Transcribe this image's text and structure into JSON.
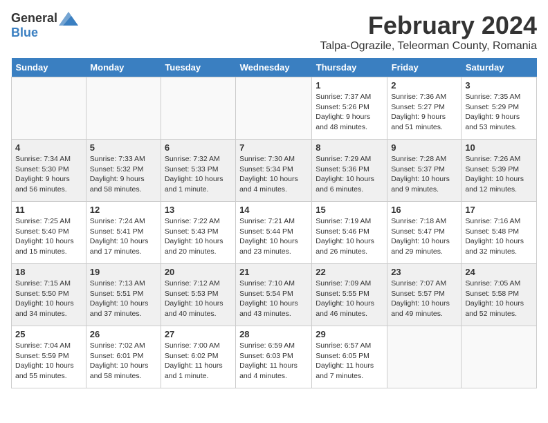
{
  "header": {
    "logo_general": "General",
    "logo_blue": "Blue",
    "month_title": "February 2024",
    "location": "Talpa-Ograzile, Teleorman County, Romania"
  },
  "days_of_week": [
    "Sunday",
    "Monday",
    "Tuesday",
    "Wednesday",
    "Thursday",
    "Friday",
    "Saturday"
  ],
  "weeks": [
    [
      {
        "day": "",
        "info": ""
      },
      {
        "day": "",
        "info": ""
      },
      {
        "day": "",
        "info": ""
      },
      {
        "day": "",
        "info": ""
      },
      {
        "day": "1",
        "info": "Sunrise: 7:37 AM\nSunset: 5:26 PM\nDaylight: 9 hours and 48 minutes."
      },
      {
        "day": "2",
        "info": "Sunrise: 7:36 AM\nSunset: 5:27 PM\nDaylight: 9 hours and 51 minutes."
      },
      {
        "day": "3",
        "info": "Sunrise: 7:35 AM\nSunset: 5:29 PM\nDaylight: 9 hours and 53 minutes."
      }
    ],
    [
      {
        "day": "4",
        "info": "Sunrise: 7:34 AM\nSunset: 5:30 PM\nDaylight: 9 hours and 56 minutes."
      },
      {
        "day": "5",
        "info": "Sunrise: 7:33 AM\nSunset: 5:32 PM\nDaylight: 9 hours and 58 minutes."
      },
      {
        "day": "6",
        "info": "Sunrise: 7:32 AM\nSunset: 5:33 PM\nDaylight: 10 hours and 1 minute."
      },
      {
        "day": "7",
        "info": "Sunrise: 7:30 AM\nSunset: 5:34 PM\nDaylight: 10 hours and 4 minutes."
      },
      {
        "day": "8",
        "info": "Sunrise: 7:29 AM\nSunset: 5:36 PM\nDaylight: 10 hours and 6 minutes."
      },
      {
        "day": "9",
        "info": "Sunrise: 7:28 AM\nSunset: 5:37 PM\nDaylight: 10 hours and 9 minutes."
      },
      {
        "day": "10",
        "info": "Sunrise: 7:26 AM\nSunset: 5:39 PM\nDaylight: 10 hours and 12 minutes."
      }
    ],
    [
      {
        "day": "11",
        "info": "Sunrise: 7:25 AM\nSunset: 5:40 PM\nDaylight: 10 hours and 15 minutes."
      },
      {
        "day": "12",
        "info": "Sunrise: 7:24 AM\nSunset: 5:41 PM\nDaylight: 10 hours and 17 minutes."
      },
      {
        "day": "13",
        "info": "Sunrise: 7:22 AM\nSunset: 5:43 PM\nDaylight: 10 hours and 20 minutes."
      },
      {
        "day": "14",
        "info": "Sunrise: 7:21 AM\nSunset: 5:44 PM\nDaylight: 10 hours and 23 minutes."
      },
      {
        "day": "15",
        "info": "Sunrise: 7:19 AM\nSunset: 5:46 PM\nDaylight: 10 hours and 26 minutes."
      },
      {
        "day": "16",
        "info": "Sunrise: 7:18 AM\nSunset: 5:47 PM\nDaylight: 10 hours and 29 minutes."
      },
      {
        "day": "17",
        "info": "Sunrise: 7:16 AM\nSunset: 5:48 PM\nDaylight: 10 hours and 32 minutes."
      }
    ],
    [
      {
        "day": "18",
        "info": "Sunrise: 7:15 AM\nSunset: 5:50 PM\nDaylight: 10 hours and 34 minutes."
      },
      {
        "day": "19",
        "info": "Sunrise: 7:13 AM\nSunset: 5:51 PM\nDaylight: 10 hours and 37 minutes."
      },
      {
        "day": "20",
        "info": "Sunrise: 7:12 AM\nSunset: 5:53 PM\nDaylight: 10 hours and 40 minutes."
      },
      {
        "day": "21",
        "info": "Sunrise: 7:10 AM\nSunset: 5:54 PM\nDaylight: 10 hours and 43 minutes."
      },
      {
        "day": "22",
        "info": "Sunrise: 7:09 AM\nSunset: 5:55 PM\nDaylight: 10 hours and 46 minutes."
      },
      {
        "day": "23",
        "info": "Sunrise: 7:07 AM\nSunset: 5:57 PM\nDaylight: 10 hours and 49 minutes."
      },
      {
        "day": "24",
        "info": "Sunrise: 7:05 AM\nSunset: 5:58 PM\nDaylight: 10 hours and 52 minutes."
      }
    ],
    [
      {
        "day": "25",
        "info": "Sunrise: 7:04 AM\nSunset: 5:59 PM\nDaylight: 10 hours and 55 minutes."
      },
      {
        "day": "26",
        "info": "Sunrise: 7:02 AM\nSunset: 6:01 PM\nDaylight: 10 hours and 58 minutes."
      },
      {
        "day": "27",
        "info": "Sunrise: 7:00 AM\nSunset: 6:02 PM\nDaylight: 11 hours and 1 minute."
      },
      {
        "day": "28",
        "info": "Sunrise: 6:59 AM\nSunset: 6:03 PM\nDaylight: 11 hours and 4 minutes."
      },
      {
        "day": "29",
        "info": "Sunrise: 6:57 AM\nSunset: 6:05 PM\nDaylight: 11 hours and 7 minutes."
      },
      {
        "day": "",
        "info": ""
      },
      {
        "day": "",
        "info": ""
      }
    ]
  ]
}
